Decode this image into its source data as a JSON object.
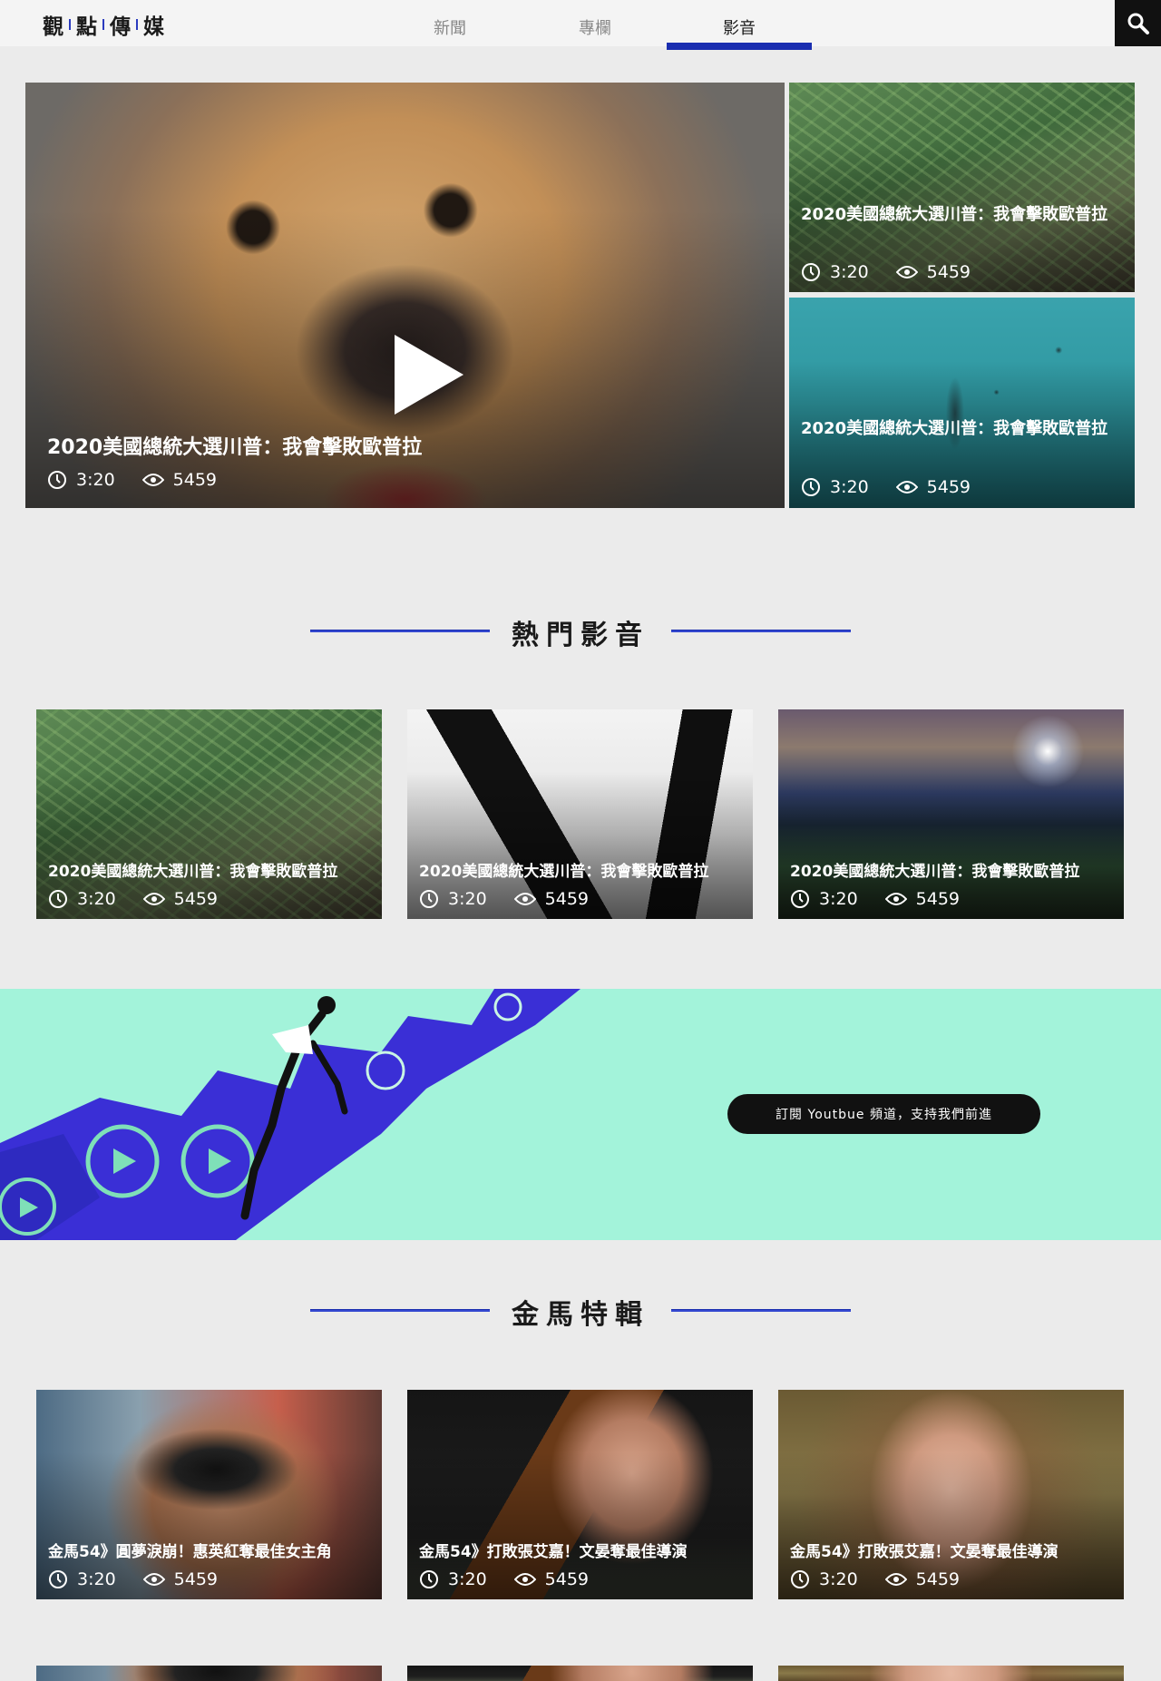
{
  "header": {
    "logo_chars": [
      "觀",
      "點",
      "傳",
      "媒"
    ],
    "nav": [
      {
        "label": "新聞",
        "active": false
      },
      {
        "label": "專欄",
        "active": false
      },
      {
        "label": "影音",
        "active": true
      }
    ],
    "search_icon": "search-icon"
  },
  "hero": {
    "main": {
      "title": "2020美國總統大選川普：我會擊敗歐普拉",
      "duration": "3:20",
      "views": "5459"
    },
    "side": [
      {
        "title": "2020美國總統大選川普：我會擊敗歐普拉",
        "duration": "3:20",
        "views": "5459"
      },
      {
        "title": "2020美國總統大選川普：我會擊敗歐普拉",
        "duration": "3:20",
        "views": "5459"
      }
    ]
  },
  "popular": {
    "heading": "熱門影音",
    "items": [
      {
        "title": "2020美國總統大選川普：我會擊敗歐普拉",
        "duration": "3:20",
        "views": "5459"
      },
      {
        "title": "2020美國總統大選川普：我會擊敗歐普拉",
        "duration": "3:20",
        "views": "5459"
      },
      {
        "title": "2020美國總統大選川普：我會擊敗歐普拉",
        "duration": "3:20",
        "views": "5459"
      }
    ]
  },
  "banner": {
    "button_label": "訂閱 Youtbue 頻道，支持我們前進"
  },
  "golden_horse": {
    "heading": "金馬特輯",
    "items": [
      {
        "title": "金馬54》圓夢淚崩！惠英紅奪最佳女主角",
        "duration": "3:20",
        "views": "5459"
      },
      {
        "title": "金馬54》打敗張艾嘉！文晏奪最佳導演",
        "duration": "3:20",
        "views": "5459"
      },
      {
        "title": "金馬54》打敗張艾嘉！文晏奪最佳導演",
        "duration": "3:20",
        "views": "5459"
      }
    ]
  },
  "colors": {
    "accent": "#1a2eb0",
    "banner_bg": "#a3f3da",
    "page_bg": "#ebebeb"
  }
}
